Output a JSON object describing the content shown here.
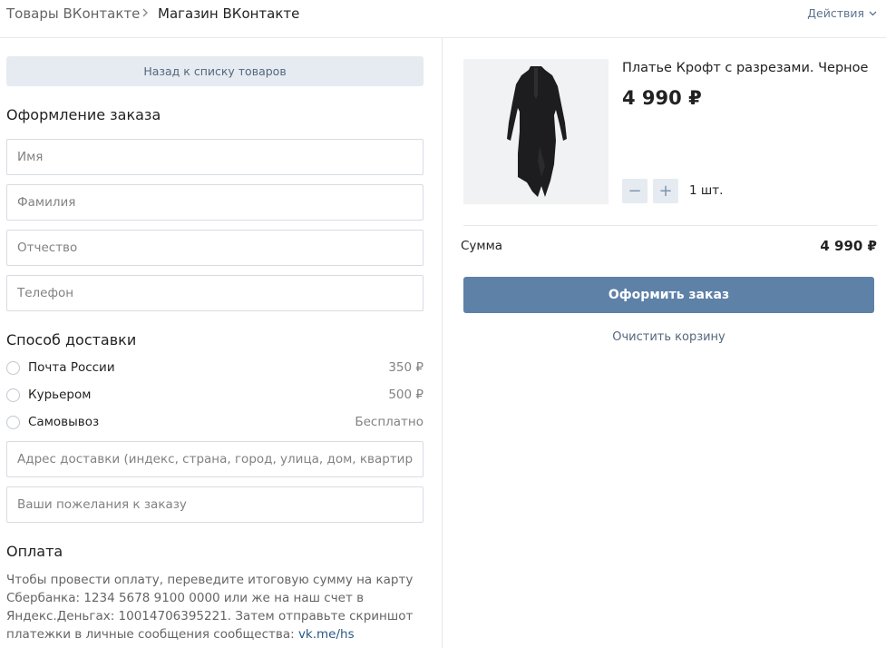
{
  "header": {
    "breadcrumb_1": "Товары ВКонтакте",
    "breadcrumb_2": "Магазин ВКонтакте",
    "actions_label": "Действия"
  },
  "form": {
    "back_label": "Назад к списку товаров",
    "order_title": "Оформление заказа",
    "fields": {
      "first_name_placeholder": "Имя",
      "last_name_placeholder": "Фамилия",
      "patronymic_placeholder": "Отчество",
      "phone_placeholder": "Телефон"
    },
    "delivery_title": "Способ доставки",
    "delivery_options": [
      {
        "label": "Почта России",
        "price": "350 ₽"
      },
      {
        "label": "Курьером",
        "price": "500 ₽"
      },
      {
        "label": "Самовывоз",
        "price": "Бесплатно"
      }
    ],
    "address_placeholder": "Адрес доставки (индекс, страна, город, улица, дом, квартира)",
    "wishes_placeholder": "Ваши пожелания к заказу",
    "payment_title": "Оплата",
    "payment_text": "Чтобы провести оплату, переведите итоговую сумму на карту Сбербанка: 1234 5678 9100 0000 или же на наш счет в Яндекс.Деньгах: 10014706395221. Затем отправьте скриншот платежки в личные сообщения сообщества: ",
    "payment_link": "vk.me/hs"
  },
  "cart": {
    "product_title": "Платье Крофт с разрезами. Черное",
    "product_price": "4 990 ₽",
    "quantity": "1 шт.",
    "minus": "−",
    "plus": "+",
    "sum_label": "Сумма",
    "sum_value": "4 990 ₽",
    "order_button": "Оформить заказ",
    "clear_label": "Очистить корзину"
  },
  "colors": {
    "accent": "#5e81a8",
    "link": "#2a5885",
    "secondary_button_bg": "#e5ebf1"
  }
}
